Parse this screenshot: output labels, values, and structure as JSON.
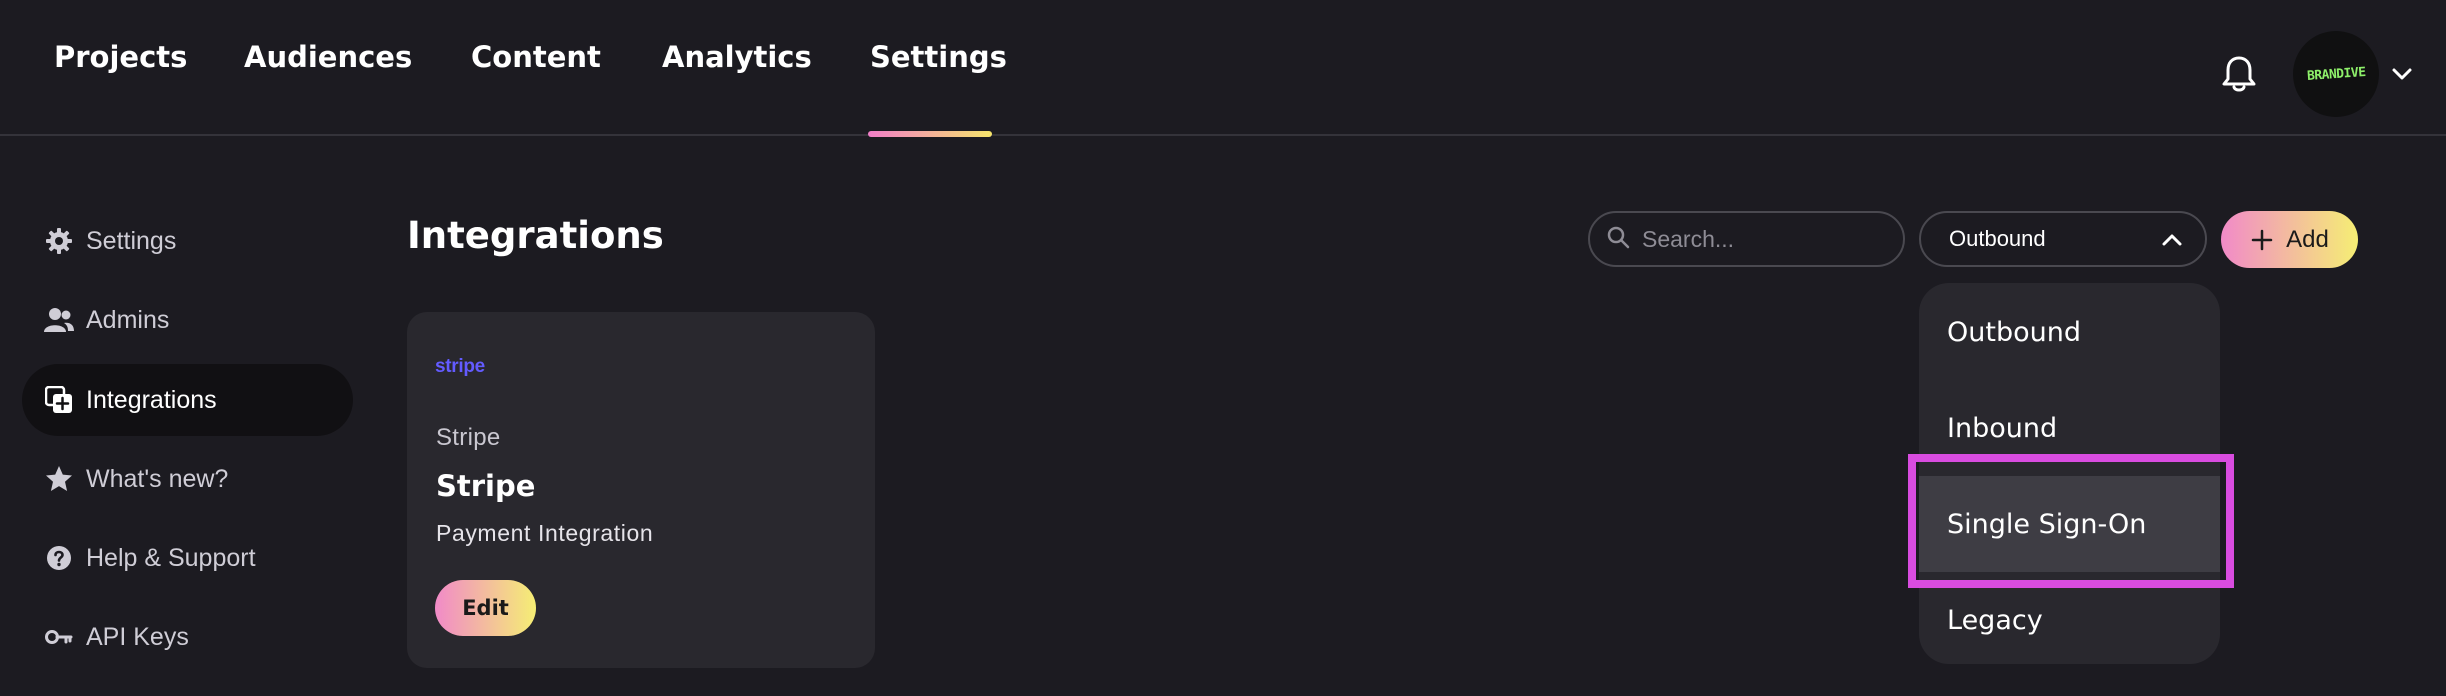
{
  "nav": {
    "items": [
      {
        "label": "Projects"
      },
      {
        "label": "Audiences"
      },
      {
        "label": "Content"
      },
      {
        "label": "Analytics"
      },
      {
        "label": "Settings",
        "active": true
      }
    ]
  },
  "header": {
    "bell_icon": "bell-icon",
    "avatar_logo_text": "BRANDIVE",
    "avatar_chevron_icon": "chevron-down-icon"
  },
  "sidebar": {
    "items": [
      {
        "label": "Settings",
        "icon": "gear-icon"
      },
      {
        "label": "Admins",
        "icon": "users-icon"
      },
      {
        "label": "Integrations",
        "icon": "integrations-icon",
        "active": true
      },
      {
        "label": "What's new?",
        "icon": "star-icon"
      },
      {
        "label": "Help & Support",
        "icon": "help-icon"
      },
      {
        "label": "API Keys",
        "icon": "key-icon"
      }
    ]
  },
  "main": {
    "title": "Integrations",
    "search": {
      "placeholder": "Search...",
      "value": ""
    },
    "filter": {
      "selected": "Outbound",
      "icon": "chevron-up-icon"
    },
    "add_button": {
      "label": "Add",
      "icon": "plus-icon"
    },
    "dropdown": {
      "options": [
        "Outbound",
        "Inbound",
        "Single Sign-On",
        "Legacy"
      ],
      "highlighted": "Single Sign-On"
    },
    "cards": [
      {
        "logo_text": "stripe",
        "provider": "Stripe",
        "name": "Stripe",
        "description": "Payment Integration",
        "button_label": "Edit"
      }
    ]
  },
  "colors": {
    "background": "#1c1b21",
    "card": "#29282e",
    "accent_gradient_start": "#f18ac8",
    "accent_gradient_end": "#f5ee74",
    "highlight_border": "#d94ce0",
    "stripe_brand": "#635bff"
  }
}
